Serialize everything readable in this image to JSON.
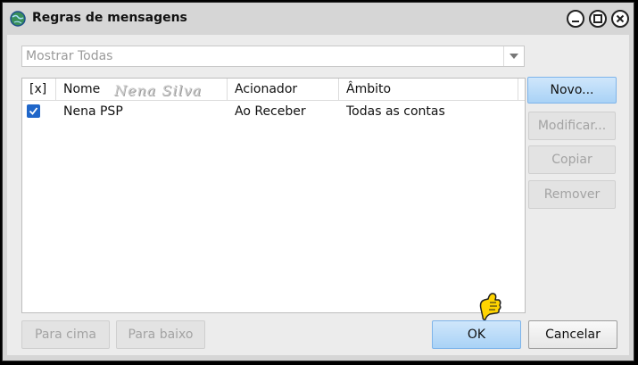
{
  "window": {
    "title": "Regras de mensagens"
  },
  "filter": {
    "value": "Mostrar Todas"
  },
  "table": {
    "columns": [
      "[x]",
      "Nome",
      "Acionador",
      "Âmbito"
    ],
    "rows": [
      {
        "checked": true,
        "name": "Nena PSP",
        "trigger": "Ao Receber",
        "scope": "Todas as contas"
      }
    ]
  },
  "watermark": "Nena Silva",
  "buttons": {
    "new": "Novo...",
    "modify": "Modificar...",
    "copy": "Copiar",
    "remove": "Remover",
    "move_up": "Para cima",
    "move_down": "Para baixo",
    "ok": "OK",
    "cancel": "Cancelar"
  },
  "colors": {
    "accent": "#1f66c9",
    "primary_button": "#b9dcf8"
  }
}
